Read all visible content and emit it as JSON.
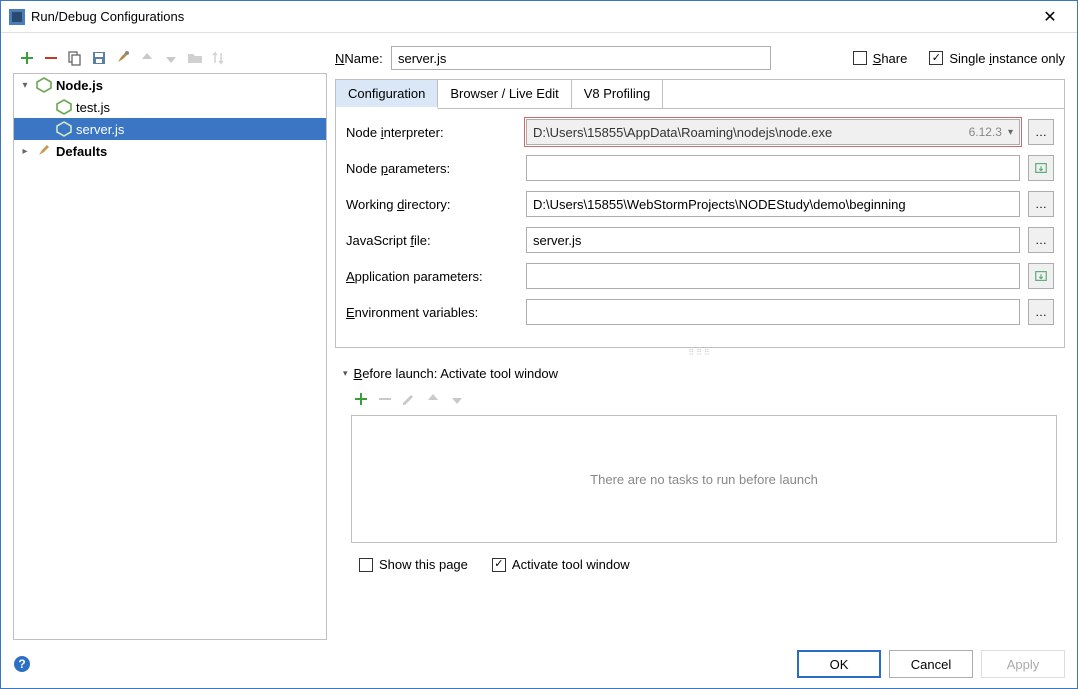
{
  "title": "Run/Debug Configurations",
  "tree": {
    "nodejs_label": "Node.js",
    "items": [
      "test.js",
      "server.js"
    ],
    "defaults_label": "Defaults"
  },
  "name_label": "Name:",
  "name_value": "server.js",
  "share_label": "Share",
  "single_instance_label": "Single instance only",
  "tabs": [
    "Configuration",
    "Browser / Live Edit",
    "V8 Profiling"
  ],
  "form": {
    "node_interpreter_label": "Node interpreter:",
    "node_interpreter_value": "D:\\Users\\15855\\AppData\\Roaming\\nodejs\\node.exe",
    "node_interpreter_version": "6.12.3",
    "node_params_label": "Node parameters:",
    "node_params_value": "",
    "workdir_label": "Working directory:",
    "workdir_value": "D:\\Users\\15855\\WebStormProjects\\NODEStudy\\demo\\beginning",
    "jsfile_label": "JavaScript file:",
    "jsfile_value": "server.js",
    "app_params_label": "Application parameters:",
    "app_params_value": "",
    "env_label": "Environment variables:",
    "env_value": ""
  },
  "before_launch": {
    "title": "Before launch: Activate tool window",
    "placeholder": "There are no tasks to run before launch",
    "show_page_label": "Show this page",
    "activate_label": "Activate tool window"
  },
  "buttons": {
    "ok": "OK",
    "cancel": "Cancel",
    "apply": "Apply"
  }
}
